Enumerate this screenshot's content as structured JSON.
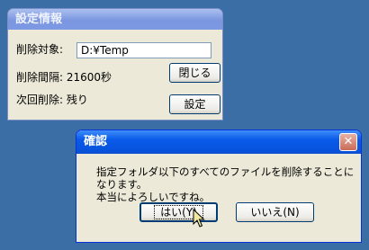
{
  "settings_window": {
    "title": "設定情報",
    "target_label": "削除対象:",
    "target_value": "D:¥Temp",
    "interval_text": "削除間隔: 21600秒",
    "next_text": "次回削除: 残り",
    "close_button": "閉じる",
    "settings_button": "設定"
  },
  "confirm_dialog": {
    "title": "確認",
    "close_icon": "close-icon",
    "message_line1": "指定フォルダ以下のすべてのファイルを削除することになります。",
    "message_line2": "本当によろしいですね。",
    "yes_button": "はい(Y)",
    "no_button": "いいえ(N)"
  },
  "colors": {
    "desktop": "#3a6ea5",
    "inactive_title": "#7b96e0",
    "active_title": "#0754e0",
    "window_face": "#ece9d8"
  }
}
